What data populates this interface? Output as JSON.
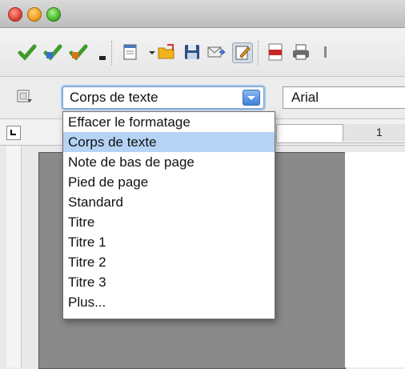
{
  "titlebar": {
    "buttons": [
      "close-button",
      "minimize-button",
      "zoom-button"
    ]
  },
  "toolbar": {
    "icons": [
      "green-check-icon",
      "blue-check-icon",
      "orange-check-icon",
      "more-arrow-icon",
      "new-document-icon",
      "open-folder-icon",
      "save-icon",
      "email-icon",
      "edit-mode-icon",
      "export-pdf-icon",
      "print-icon"
    ]
  },
  "format_bar": {
    "style_value": "Corps de texte",
    "font_value": "Arial"
  },
  "ruler": {
    "mark": "1"
  },
  "dropdown": {
    "items": [
      "Effacer le formatage",
      "Corps de texte",
      "Note de bas de page",
      "Pied de page",
      "Standard",
      "Titre",
      "Titre 1",
      "Titre 2",
      "Titre 3",
      "Plus..."
    ],
    "selected_index": 1
  }
}
